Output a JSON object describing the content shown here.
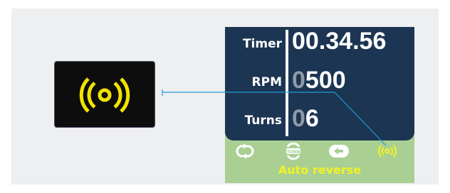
{
  "display": {
    "rows": [
      {
        "label": "Timer",
        "value_dim": "",
        "value_bright": "00.34.56"
      },
      {
        "label": "RPM",
        "value_dim": "0",
        "value_bright": "500"
      },
      {
        "label": "Turns",
        "value_dim": "0",
        "value_bright": "6"
      }
    ]
  },
  "status": {
    "caption": "Auto reverse",
    "icons": [
      "loop-arrows-icon",
      "turn-icon",
      "reverse-arrow-icon",
      "auto-reverse-waves-icon"
    ],
    "active_icon": "auto-reverse-waves-icon",
    "colors": {
      "active": "#f2f224",
      "inactive": "#ffffff",
      "bar": "#a9cf93",
      "lcd": "#1c3552"
    }
  },
  "callout": {
    "icon": "auto-reverse-waves-icon",
    "color": "#f2e300",
    "line_color": "#1f9ad6"
  }
}
